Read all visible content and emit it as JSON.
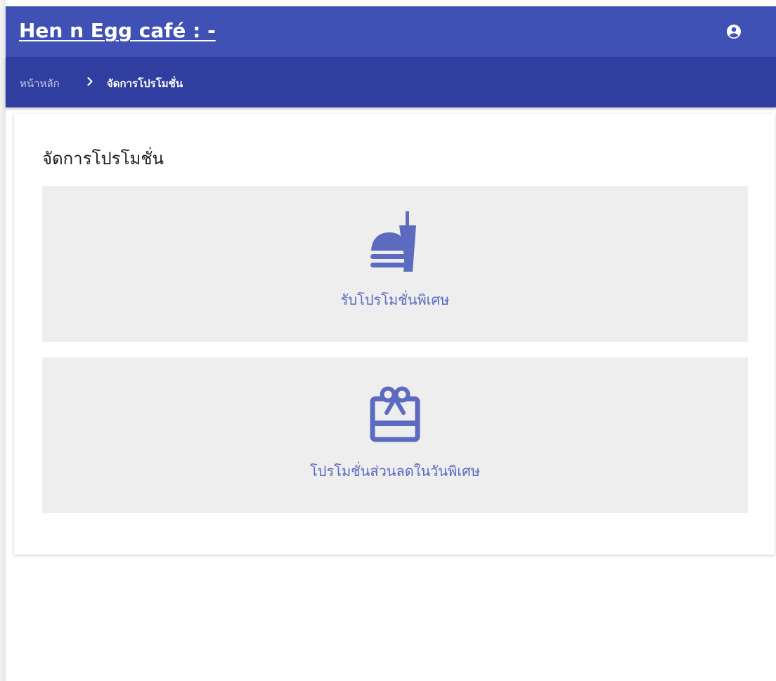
{
  "header": {
    "title": "Hen n Egg café : -",
    "account_icon": "account-circle-icon",
    "color": "#3f51b5"
  },
  "breadcrumb": {
    "home": "หน้าหลัก",
    "separator_icon": "chevron-right-icon",
    "current": "จัดการโปรโมชั่น",
    "color": "#303f9f"
  },
  "main": {
    "title": "จัดการโปรโมชั่น",
    "tiles": [
      {
        "label": "รับโปรโมชั่นพิเศษ",
        "icon": "fastfood-icon"
      },
      {
        "label": "โปรโมชั่นส่วนลดในวันพิเศษ",
        "icon": "card-giftcard-icon"
      }
    ],
    "accent": "#5c6bc0",
    "tile_bg": "#eeeeee"
  }
}
